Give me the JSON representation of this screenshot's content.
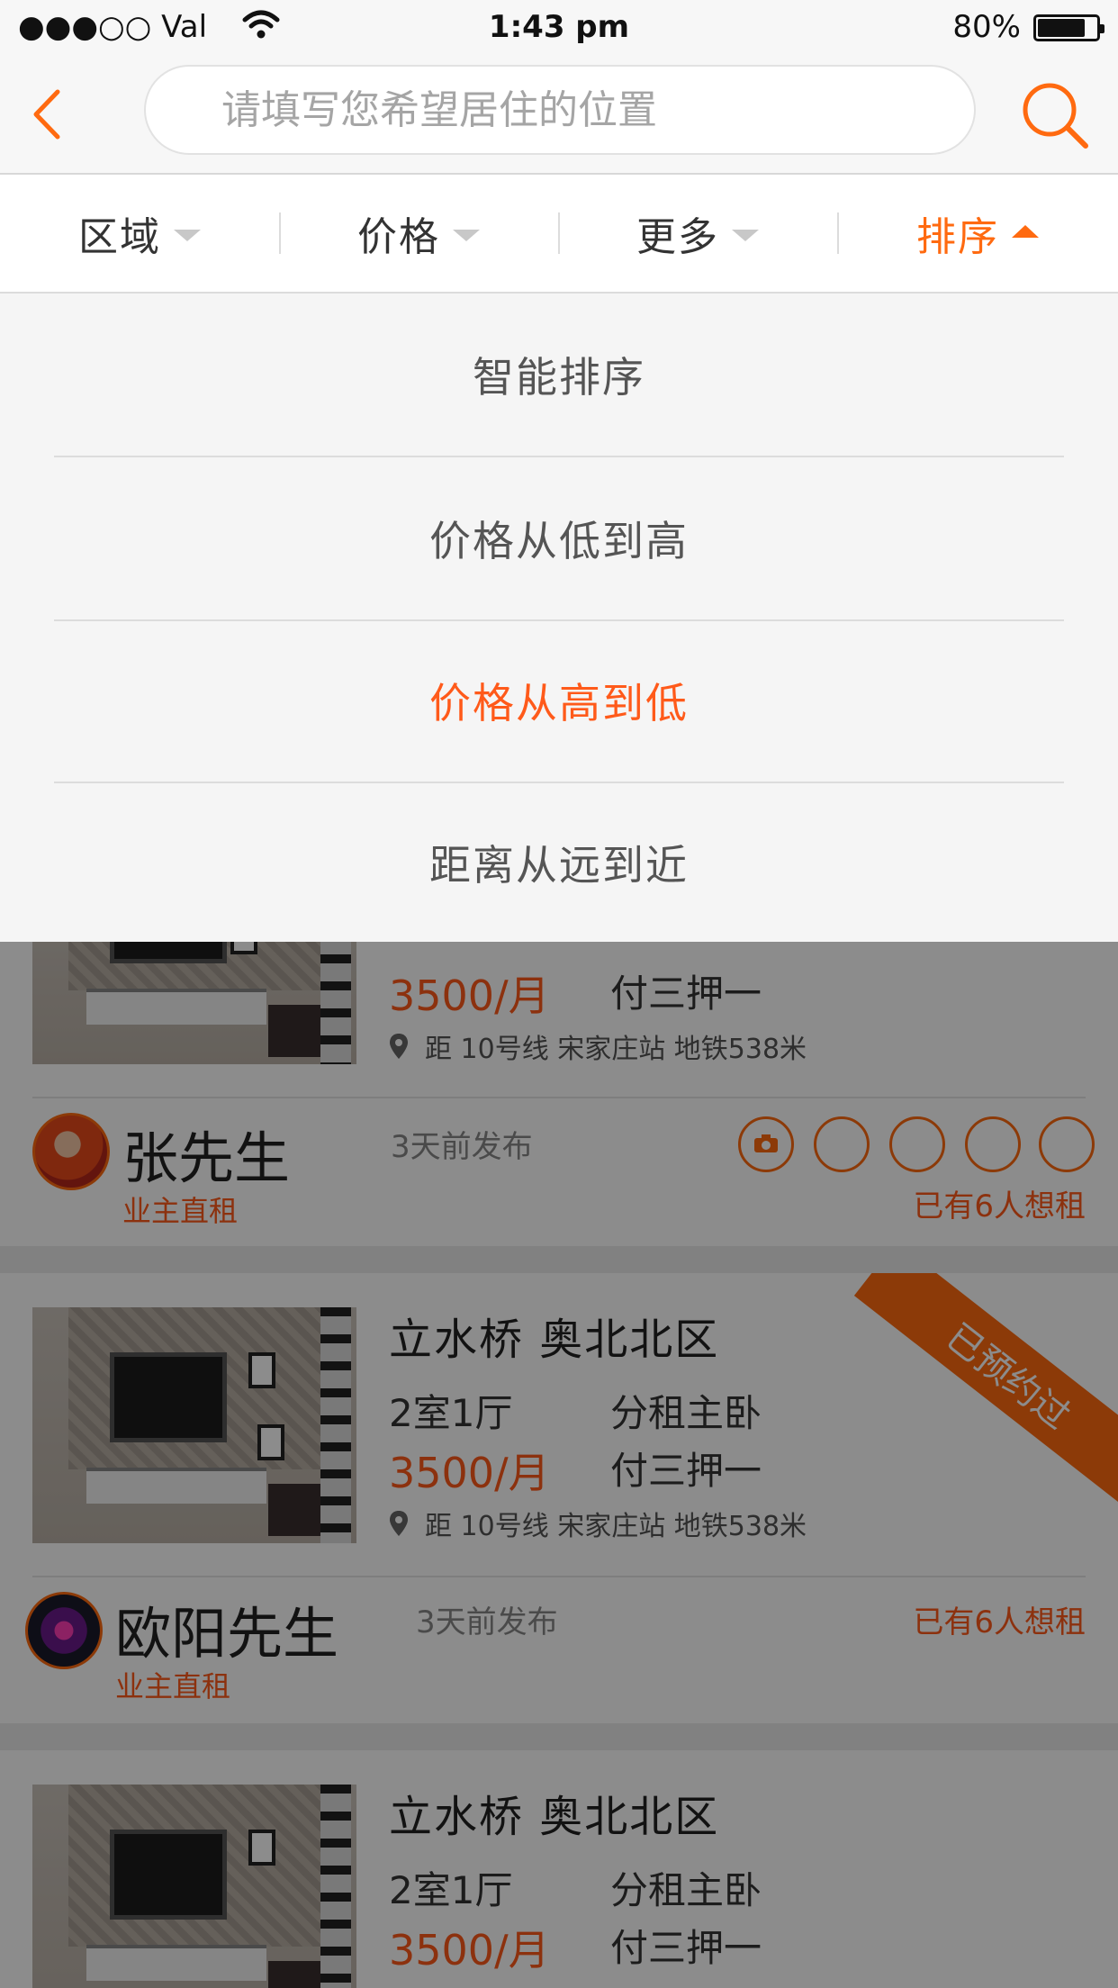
{
  "status_bar": {
    "carrier": "●●●○○ Val",
    "time": "1:43 pm",
    "battery": "80%",
    "battery_level": 0.8
  },
  "nav": {
    "search_placeholder": "请填写您希望居住的位置",
    "back_icon": "chevron-left-icon",
    "search_icon": "search-icon"
  },
  "filters": [
    {
      "label": "区域",
      "active": false
    },
    {
      "label": "价格",
      "active": false
    },
    {
      "label": "更多",
      "active": false
    },
    {
      "label": "排序",
      "active": true
    }
  ],
  "sort_options": [
    {
      "label": "智能排序",
      "selected": false
    },
    {
      "label": "价格从低到高",
      "selected": false
    },
    {
      "label": "价格从高到低",
      "selected": true
    },
    {
      "label": "距离从远到近",
      "selected": false
    }
  ],
  "listings": [
    {
      "price": "3500/月",
      "payment": "付三押一",
      "location": "距 10号线 宋家庄站 地铁538米",
      "owner": "张先生",
      "owner_tag": "业主直租",
      "posted": "3天前发布",
      "interest": "已有6人想租"
    },
    {
      "title": "立水桥 奥北北区",
      "layout": "2室1厅",
      "rent_type": "分租主卧",
      "price": "3500/月",
      "payment": "付三押一",
      "location": "距 10号线 宋家庄站 地铁538米",
      "owner": "欧阳先生",
      "owner_tag": "业主直租",
      "posted": "3天前发布",
      "interest": "已有6人想租",
      "ribbon": "已预约过"
    },
    {
      "title": "立水桥 奥北北区",
      "layout": "2室1厅",
      "rent_type": "分租主卧",
      "price": "3500/月",
      "payment": "付三押一"
    }
  ],
  "colors": {
    "accent": "#ff6a10",
    "price": "#ff5a1a",
    "overlay": "rgba(0,0,0,0.45)"
  }
}
